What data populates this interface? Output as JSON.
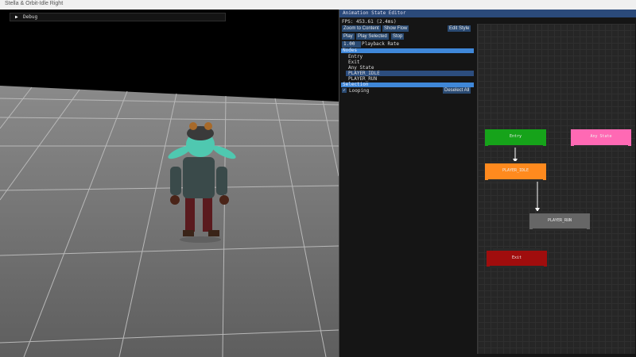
{
  "window": {
    "title": "Stella & Orbit-Idle Right"
  },
  "debug": {
    "label": "Debug",
    "triangle": "▶"
  },
  "panel": {
    "title": "Animation State Editor",
    "fps": "FPS: 453.61 (2.4ms)",
    "buttons": {
      "zoom_to_content": "Zoom to Content",
      "show_flow": "Show Flow",
      "edit_style": "Edit Style",
      "play": "Play",
      "play_selected": "Play Selected",
      "stop": "Stop"
    },
    "playback": {
      "value": "1.00",
      "label": "Playback Rate"
    },
    "nodes_header": "Nodes",
    "nodes": [
      "Entry",
      "Exit",
      "Any State",
      "PLAYER_IDLE",
      "PLAYER_RUN"
    ],
    "selected_node": "PLAYER_IDLE",
    "selection_header": "Selection",
    "looping_label": "Looping",
    "looping_checked": true,
    "deselect_all": "Deselect All"
  },
  "graph": {
    "nodes": {
      "entry": {
        "label": "Entry",
        "color": "#16a31a"
      },
      "any_state": {
        "label": "Any State",
        "color": "#ff69b4"
      },
      "player_idle": {
        "label": "PLAYER_IDLE",
        "color": "#ff8a1e"
      },
      "player_run": {
        "label": "PLAYER_RUN",
        "color": "#666666"
      },
      "exit": {
        "label": "Exit",
        "color": "#a00d0d"
      }
    }
  },
  "colors": {
    "header_blue": "#3f87d8",
    "button_blue": "#2a4a72",
    "panel_bg": "#151515"
  }
}
